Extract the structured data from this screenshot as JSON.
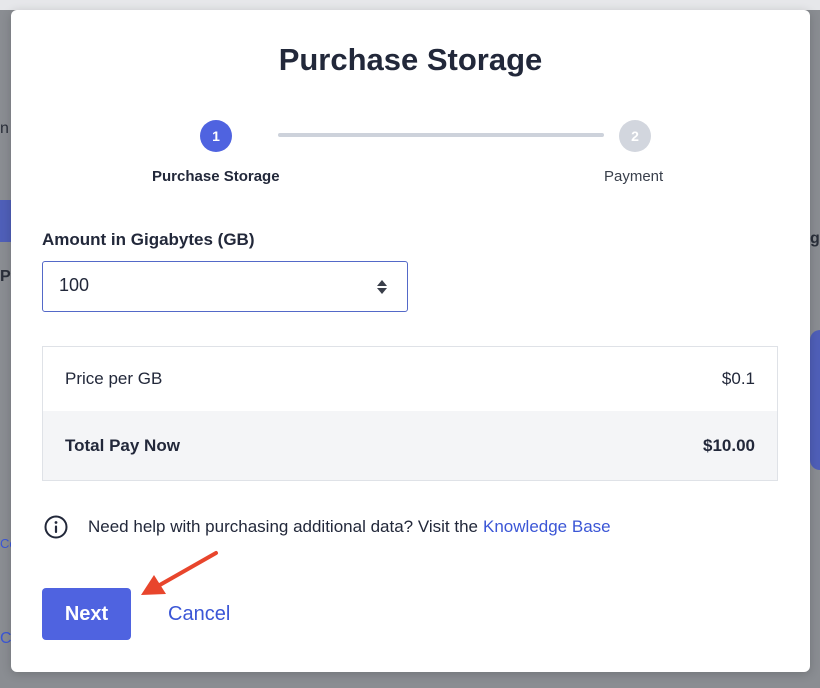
{
  "background": {
    "left_text_1": "n",
    "left_text_2": "Pr",
    "left_text_3": "Co",
    "left_text_4": "Ca",
    "right_text_1": "g"
  },
  "modal": {
    "title": "Purchase Storage",
    "steps": [
      {
        "number": "1",
        "label": "Purchase Storage",
        "state": "active"
      },
      {
        "number": "2",
        "label": "Payment",
        "state": "inactive"
      }
    ],
    "amount": {
      "label": "Amount in Gigabytes (GB)",
      "value": "100"
    },
    "pricing": {
      "rows": [
        {
          "label": "Price per GB",
          "value": "$0.1"
        },
        {
          "label": "Total Pay Now",
          "value": "$10.00"
        }
      ]
    },
    "help": {
      "icon": "info-icon",
      "text": "Need help with purchasing additional data? Visit the",
      "link_text": "Knowledge Base"
    },
    "buttons": {
      "next_label": "Next",
      "cancel_label": "Cancel"
    }
  },
  "colors": {
    "accent": "#4f63e0",
    "link": "#3b56d6",
    "annotation_arrow": "#e8452c"
  }
}
